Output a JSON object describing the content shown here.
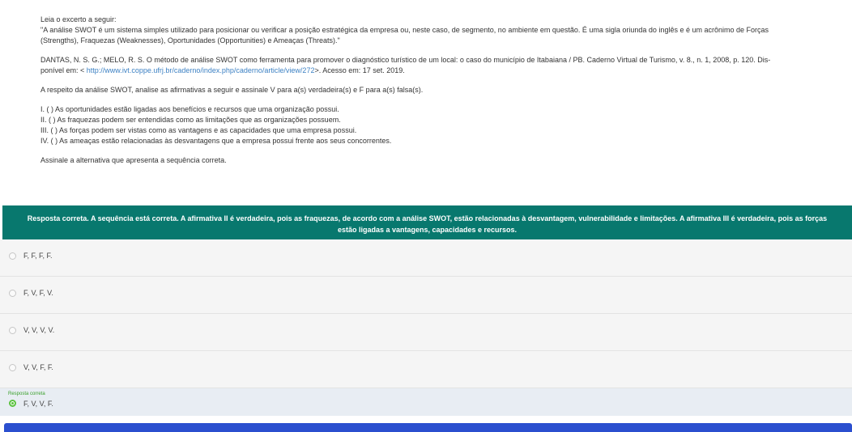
{
  "question": {
    "intro": "Leia o excerto a seguir:",
    "quote_line1": "\"A análise SWOT é um sistema simples utilizado para posicionar ou verificar a posição estratégica da empresa ou, neste caso, de segmento, no ambiente em questão. É uma sigla oriunda do inglês e é um acrônimo de Forças",
    "quote_line2": "(Strengths), Fraquezas (Weaknesses), Oportunidades (Opportunities) e Ameaças (Threats).\"",
    "ref_line1": "DANTAS, N. S. G.; MELO, R. S. O método de análise SWOT como ferramenta para promover o diagnóstico turístico de um local: o caso do município de Itabaiana / PB. Caderno Virtual de Turismo, v. 8., n. 1, 2008, p. 120. Dis-",
    "ref_line2_prefix": "ponível em: < ",
    "ref_link": "http://www.ivt.coppe.ufrj.br/caderno/index.php/caderno/article/view/272",
    "ref_line2_suffix": ">. Acesso em: 17 set. 2019.",
    "prompt": "A respeito da análise SWOT, analise as afirmativas a seguir e assinale V para a(s) verdadeira(s) e F para a(s) falsa(s).",
    "statements": [
      "I. ( ) As oportunidades estão ligadas aos benefícios e recursos que uma organização possui.",
      "II. ( ) As fraquezas podem ser entendidas como as limitações que as organizações possuem.",
      "III. ( ) As forças podem ser vistas como as vantagens e as capacidades que uma empresa possui.",
      "IV. ( ) As ameaças estão relacionadas às desvantagens que a empresa possui frente aos seus concorrentes."
    ],
    "instruction": "Assinale a alternativa que apresenta a sequência correta."
  },
  "feedback": {
    "line1": "Resposta correta.  A sequência está correta. A afirmativa II é verdadeira, pois as fraquezas, de acordo com a análise SWOT, estão relacionadas à desvantagem, vulnerabilidade e limitações. A afirmativa III é verdadeira, pois as forças",
    "line2": "estão ligadas a vantagens, capacidades e recursos.",
    "color": "#08786e"
  },
  "options": [
    {
      "label": "F, F, F, F."
    },
    {
      "label": "F, V, F, V."
    },
    {
      "label": "V, V, V, V."
    },
    {
      "label": "V, V, F, F."
    },
    {
      "label": "F, V, V, F.",
      "tag": "Resposta correta"
    }
  ],
  "colors": {
    "correct": "#5bc23f",
    "bottom_bar": "#2b4fcf"
  }
}
